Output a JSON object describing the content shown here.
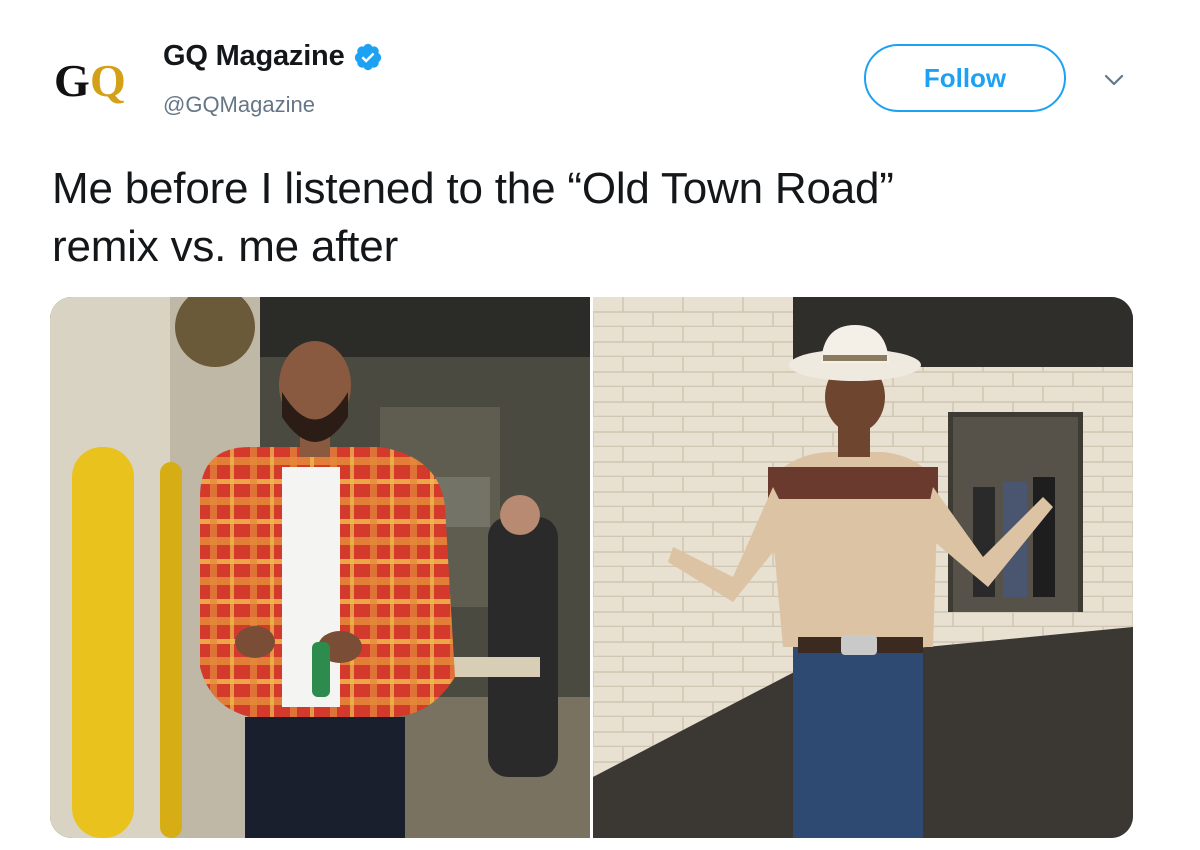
{
  "account": {
    "display_name": "GQ Magazine",
    "handle": "@GQMagazine",
    "logo_text": "GQ",
    "verified": true
  },
  "follow_button": {
    "label": "Follow"
  },
  "tweet": {
    "text_line1": "Me before I listened to the “Old Town Road”",
    "text_line2": "remix vs. me after"
  },
  "media": {
    "photos": [
      {
        "subject": "before"
      },
      {
        "subject": "after"
      }
    ]
  },
  "colors": {
    "accent": "#1da1f2",
    "text_primary": "#14171a",
    "text_secondary": "#657786",
    "logo_gold": "#d4a017"
  },
  "icons": {
    "verified": "verified-badge-icon",
    "menu": "chevron-down-icon"
  }
}
